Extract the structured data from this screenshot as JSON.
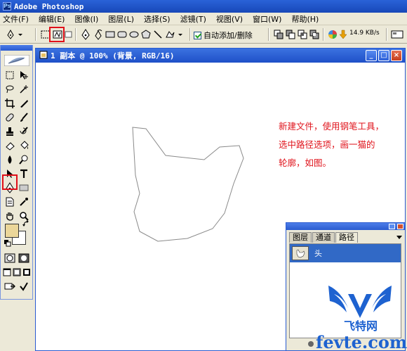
{
  "app": {
    "title": "Adobe Photoshop",
    "logo_icon": "photoshop-icon"
  },
  "menu": [
    "文件(F)",
    "编辑(E)",
    "图像(I)",
    "图层(L)",
    "选择(S)",
    "滤镜(T)",
    "视图(V)",
    "窗口(W)",
    "帮助(H)"
  ],
  "options": {
    "auto_add_delete_label": "自动添加/删除",
    "auto_add_delete_checked": true,
    "network_speed": "14.9 KB/s"
  },
  "document": {
    "title": "1 副本 @ 100% (背景, RGB/16)",
    "annotation_lines": [
      "新建文件，使用钢笔工具，",
      "选中路径选项，画一猫的",
      "轮廓，如图。"
    ],
    "annotation_color": "#e0141c"
  },
  "paths_panel": {
    "tabs": [
      "图层",
      "通道",
      "路径"
    ],
    "active_tab": "路径",
    "items": [
      {
        "label": "头"
      }
    ]
  },
  "colors": {
    "foreground": "#ebd699",
    "background": "#ffffff",
    "highlight": "#e0101a"
  },
  "watermark": {
    "text": "飞特网",
    "url": "fevte.com"
  }
}
